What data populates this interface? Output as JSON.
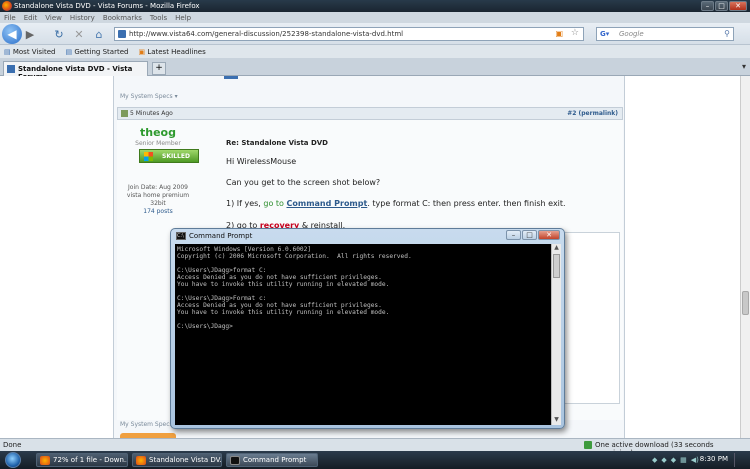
{
  "window": {
    "title": "Standalone Vista DVD - Vista Forums - Mozilla Firefox"
  },
  "menu": [
    "File",
    "Edit",
    "View",
    "History",
    "Bookmarks",
    "Tools",
    "Help"
  ],
  "nav": {
    "url": "http://www.vista64.com/general-discussion/252398-standalone-vista-dvd.html",
    "search_placeholder": "Google"
  },
  "bookmarks": [
    "Most Visited",
    "Getting Started",
    "Latest Headlines"
  ],
  "tab": {
    "title": "Standalone Vista DVD - Vista Forums"
  },
  "post": {
    "prev_system_specs": "My System Specs",
    "time": "5 Minutes Ago",
    "permalink_num": "#2",
    "permalink_label": "(permalink)",
    "username": "theog",
    "user_title": "Senior Member",
    "badge": "SKILLED",
    "join_date": "Join Date: Aug 2009",
    "os": "vista home premium",
    "arch": "32bit",
    "posts": "174 posts",
    "title": "Re: Standalone Vista DVD",
    "greeting": "Hi WirelessMouse",
    "question": "Can you get to the screen shot below?",
    "step1_prefix": "1) If yes,",
    "step1_goto": "go to",
    "step1_link": "Command Prompt",
    "step1_rest": ". type format C: then press enter. then finish exit.",
    "step2_prefix": "2) go to",
    "step2_link": "recovery",
    "step2_rest": "& reinstall.",
    "system_specs": "My System Specs"
  },
  "cmd": {
    "title": "Command Prompt",
    "lines": [
      "Microsoft Windows [Version 6.0.6002]",
      "Copyright (c) 2006 Microsoft Corporation.  All rights reserved.",
      "",
      "C:\\Users\\JDagg>format C:",
      "Access Denied as you do not have sufficient privileges.",
      "You have to invoke this utility running in elevated mode.",
      "",
      "C:\\Users\\JDagg>Format c:",
      "Access Denied as you do not have sufficient privileges.",
      "You have to invoke this utility running in elevated mode.",
      "",
      "C:\\Users\\JDagg>"
    ]
  },
  "status": {
    "left": "Done",
    "download": "One active download (33 seconds remaining)"
  },
  "taskbar": {
    "items": [
      "72% of 1 file - Down...",
      "Standalone Vista DV...",
      "Command Prompt"
    ],
    "clock": "8:30 PM"
  },
  "colors": {
    "accent": "#2d5a8c",
    "username": "#2e9a2e",
    "link_green": "#2f8f2f",
    "recovery_red": "#c8001e"
  }
}
